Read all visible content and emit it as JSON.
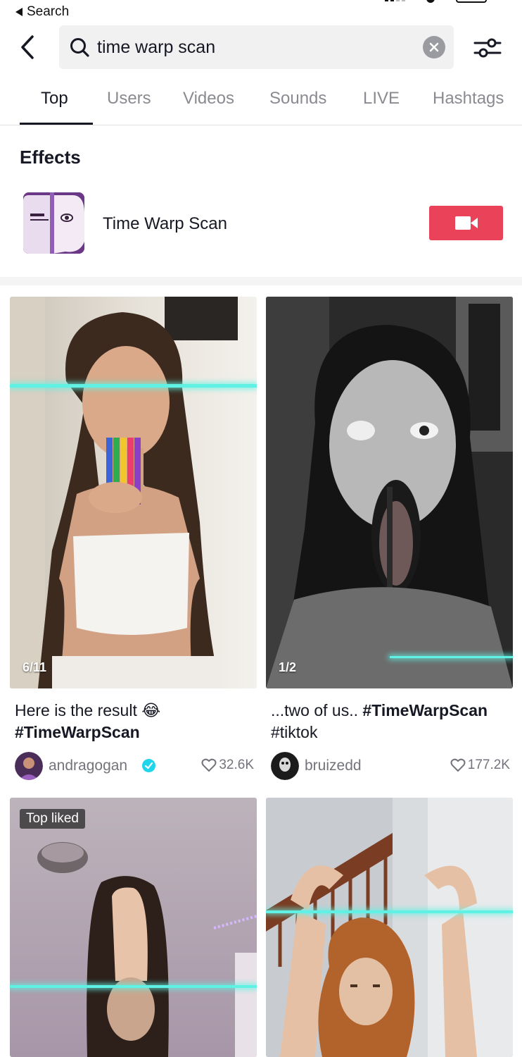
{
  "status_bar": {
    "back_label": "Search"
  },
  "search": {
    "query": "time warp scan"
  },
  "tabs": [
    {
      "label": "Top"
    },
    {
      "label": "Users"
    },
    {
      "label": "Videos"
    },
    {
      "label": "Sounds"
    },
    {
      "label": "LIVE"
    },
    {
      "label": "Hashtags"
    }
  ],
  "effects": {
    "title": "Effects",
    "item": {
      "name": "Time Warp Scan",
      "icon": "time-warp-scan-effect-icon",
      "action_icon": "video-camera-icon"
    }
  },
  "colors": {
    "accent": "#ea4359",
    "scanline": "#5ff2e4",
    "verified": "#20d5ec"
  },
  "videos": [
    {
      "badge": "6/11",
      "caption_text": "Here is the result 😂",
      "caption_tag": "#TimeWarpScan",
      "username": "andragogan",
      "verified": true,
      "likes": "32.6K"
    },
    {
      "badge": "1/2",
      "caption_text": "...two of us.. ",
      "caption_tag": "#TimeWarpScan",
      "caption_tail": "#tiktok",
      "username": "bruizedd",
      "verified": false,
      "likes": "177.2K"
    },
    {
      "label": "Top liked"
    },
    {}
  ]
}
